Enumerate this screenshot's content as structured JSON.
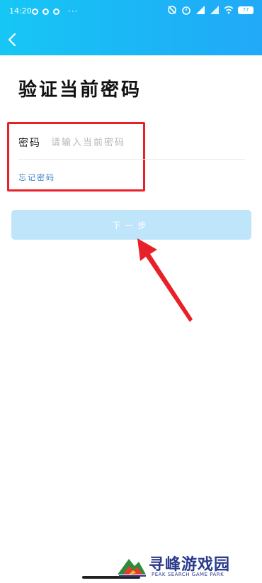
{
  "status_bar": {
    "time": "14:20",
    "more": "···",
    "battery": "77"
  },
  "header": {
    "back_icon": "chevron-left-icon"
  },
  "page": {
    "title": "验证当前密码"
  },
  "form": {
    "password_label": "密码",
    "password_placeholder": "请输入当前密码",
    "password_value": "",
    "forgot_link": "忘记密码"
  },
  "actions": {
    "next_label": "下一步"
  },
  "colors": {
    "header_gradient_start": "#16c7f5",
    "header_gradient_end": "#21a9f7",
    "highlight_box": "#e8202a",
    "annotation_arrow": "#e8202a",
    "button_disabled": "#bfe5fb",
    "link": "#3d7fc4"
  },
  "watermark": {
    "name_cn": "寻峰游戏园",
    "name_en": "PEAK SEARCH GAME PARK"
  }
}
